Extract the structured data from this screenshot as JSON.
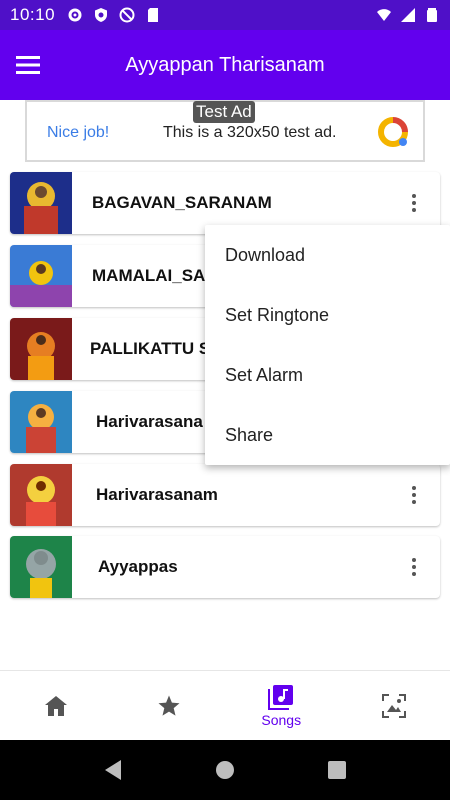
{
  "status_bar": {
    "time": "10:10"
  },
  "app_bar": {
    "title": "Ayyappan Tharisanam"
  },
  "ad": {
    "label": "Test Ad",
    "nice": "Nice job!",
    "text": "This is a 320x50 test ad."
  },
  "songs": [
    {
      "title": "BAGAVAN_SARANAM"
    },
    {
      "title": "MAMALAI_SA"
    },
    {
      "title": "PALLIKATTU S"
    },
    {
      "title": "Harivarasana"
    },
    {
      "title": "Harivarasanam"
    },
    {
      "title": "Ayyappas"
    }
  ],
  "context_menu": {
    "items": [
      {
        "label": "Download"
      },
      {
        "label": "Set Ringtone"
      },
      {
        "label": "Set Alarm"
      },
      {
        "label": "Share"
      }
    ]
  },
  "bottom_nav": {
    "items": [
      {
        "icon": "home-icon",
        "label": ""
      },
      {
        "icon": "star-icon",
        "label": ""
      },
      {
        "icon": "music-library-icon",
        "label": "Songs",
        "active": true
      },
      {
        "icon": "gallery-icon",
        "label": ""
      }
    ]
  },
  "colors": {
    "primary": "#6200ee",
    "status_bar": "#4f10c8"
  }
}
